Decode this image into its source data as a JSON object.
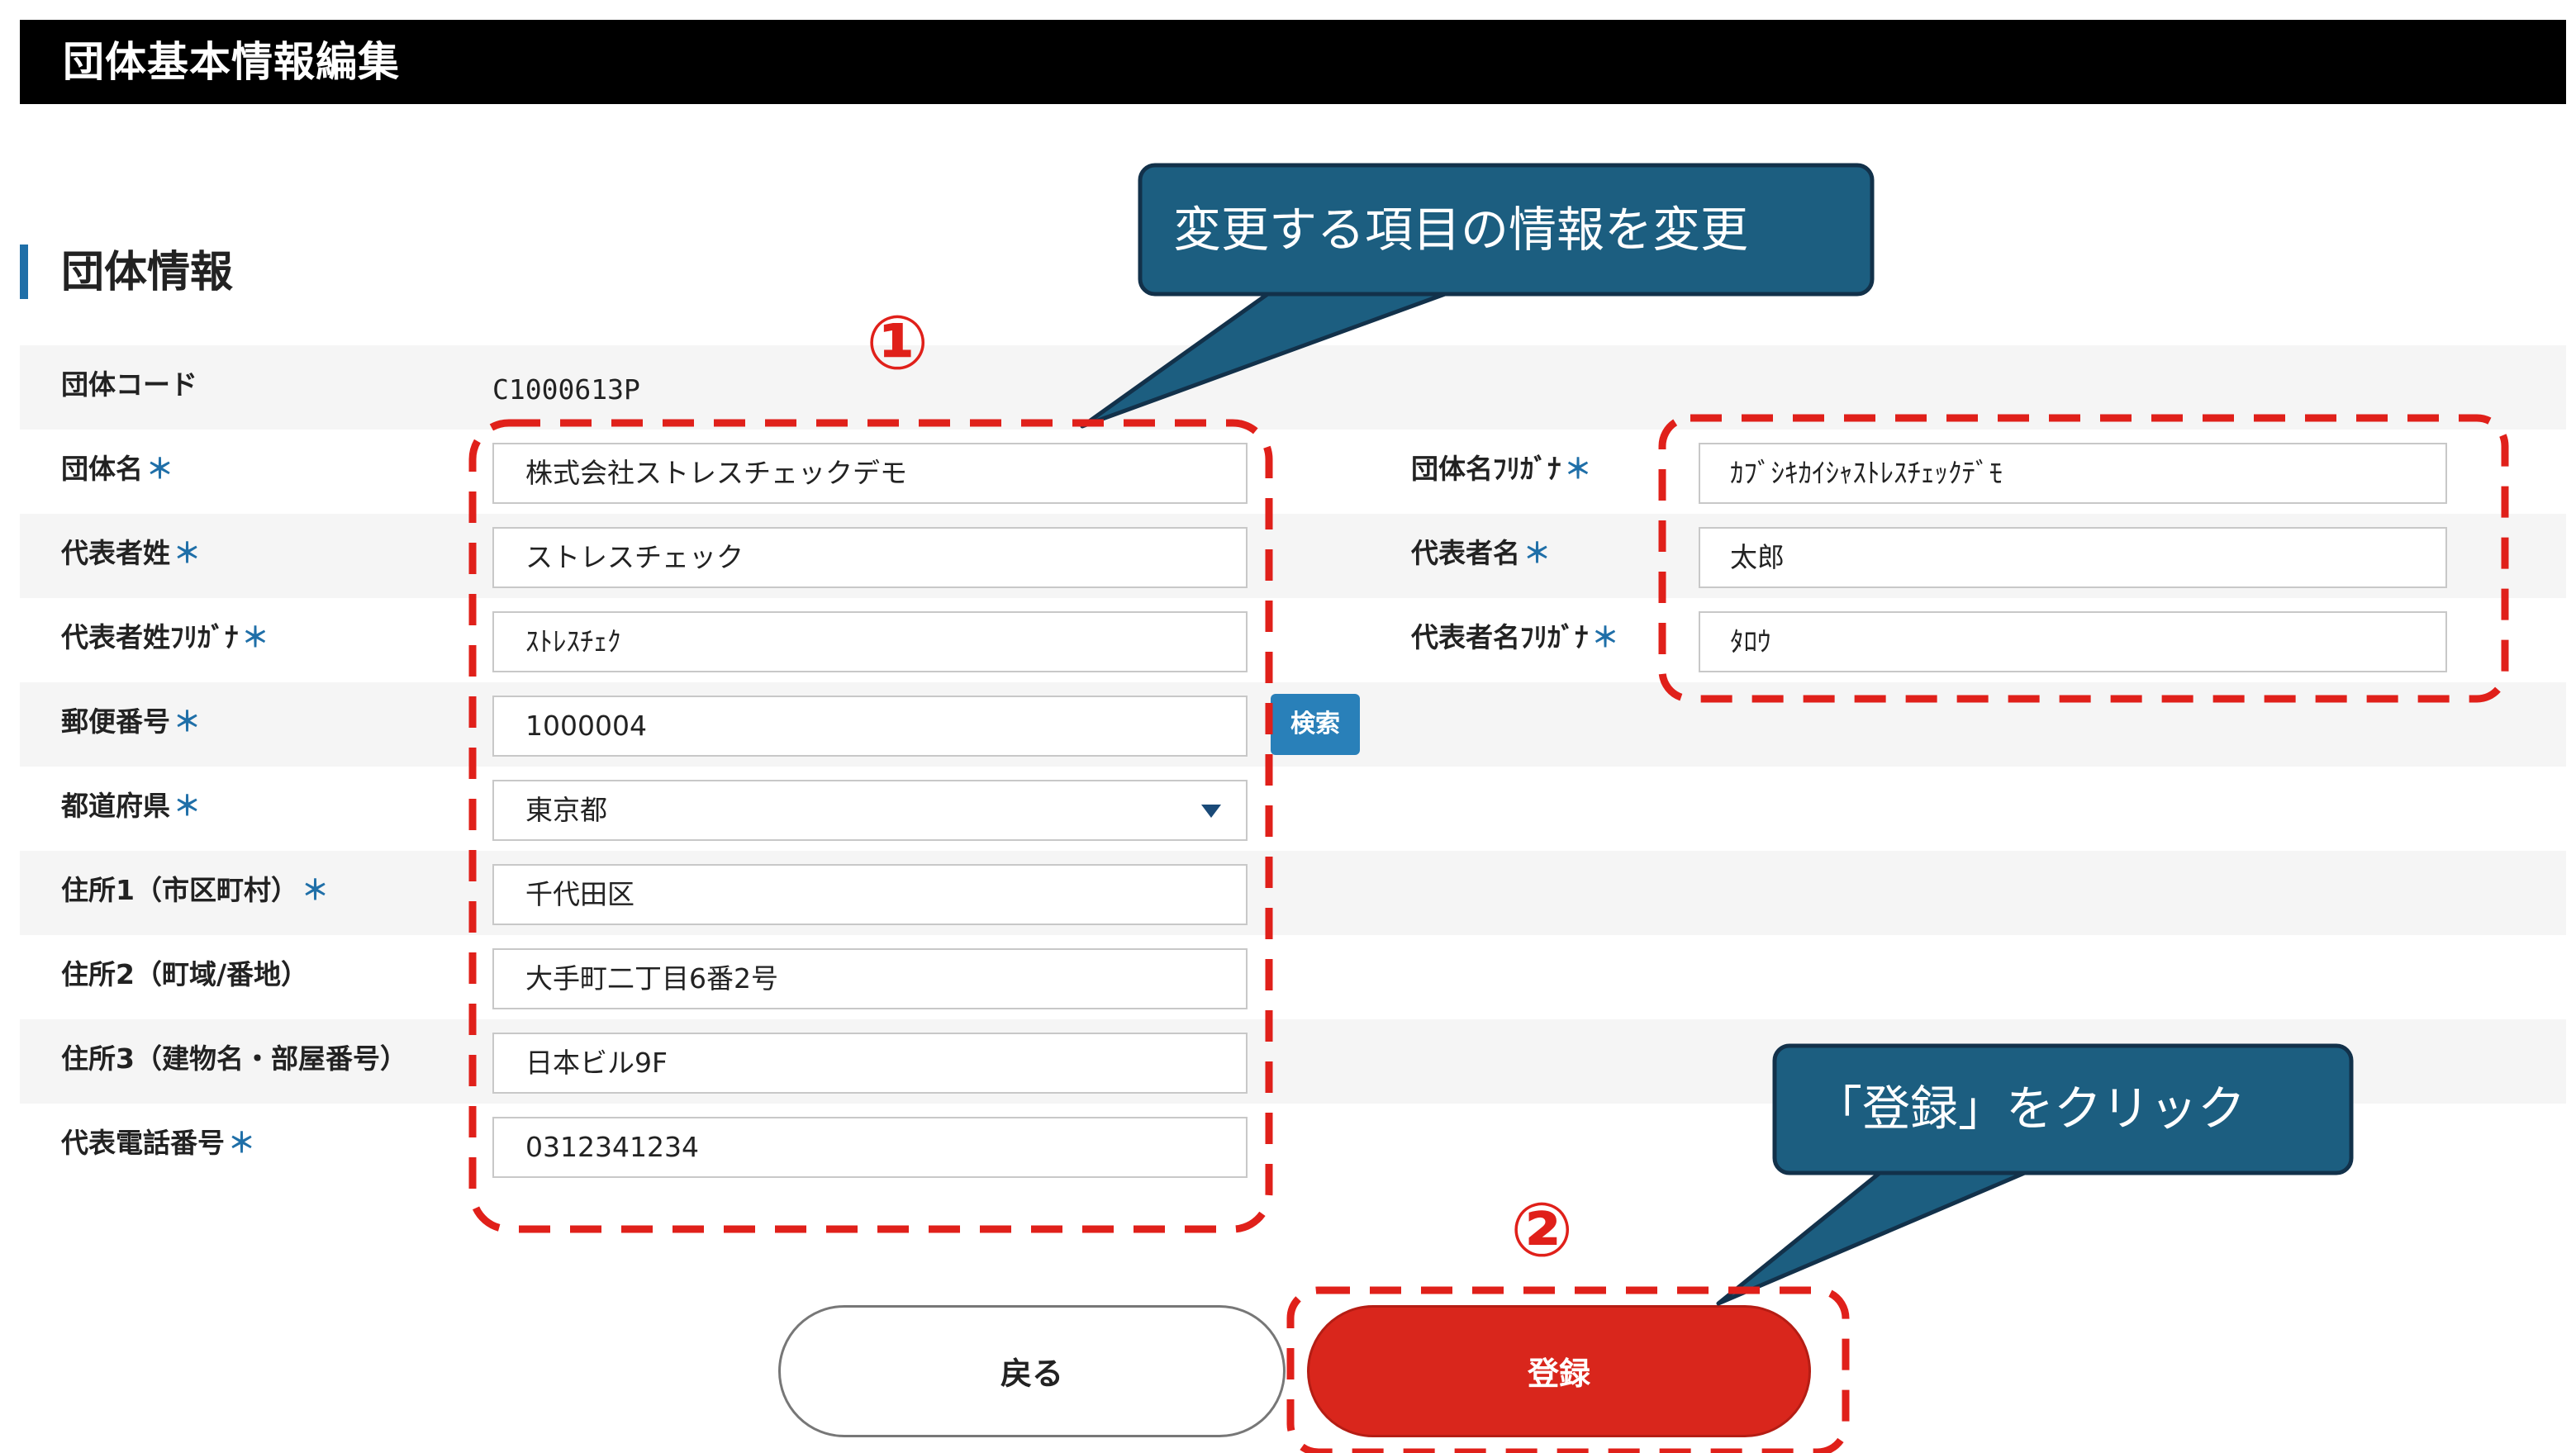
{
  "header": {
    "title": "団体基本情報編集"
  },
  "section": {
    "title": "団体情報"
  },
  "org_code": {
    "label": "団体コード",
    "value": "C1000613P"
  },
  "required_mark": "＊",
  "left_fields": [
    {
      "label": "団体名",
      "value": "株式会社ストレスチェックデモ"
    },
    {
      "label": "代表者姓",
      "value": "ストレスチェック"
    },
    {
      "label": "代表者姓ﾌﾘｶﾞﾅ",
      "value": "ｽﾄﾚｽﾁｪｸ"
    },
    {
      "label": "郵便番号",
      "value": "1000004"
    },
    {
      "label": "都道府県",
      "value": "東京都"
    },
    {
      "label": "住所1（市区町村）",
      "value": "千代田区"
    },
    {
      "label": "住所2（町域/番地）",
      "value": "大手町二丁目6番2号"
    },
    {
      "label": "住所3（建物名・部屋番号）",
      "value": "日本ビル9F"
    },
    {
      "label": "代表電話番号",
      "value": "0312341234"
    }
  ],
  "right_fields": [
    {
      "label": "団体名ﾌﾘｶﾞﾅ",
      "value": "ｶﾌﾞｼｷｶｲｼｬｽﾄﾚｽﾁｪｯｸﾃﾞﾓ"
    },
    {
      "label": "代表者名",
      "value": "太郎"
    },
    {
      "label": "代表者名ﾌﾘｶﾞﾅ",
      "value": "ﾀﾛｳ"
    }
  ],
  "search_button": "検索",
  "buttons": {
    "back": "戻る",
    "register": "登録"
  },
  "callouts": [
    {
      "marker": "①",
      "text": "変更する項目の情報を変更"
    },
    {
      "marker": "②",
      "text": "「登録」をクリック"
    }
  ],
  "colors": {
    "accent": "#1f6fa8",
    "callout_fill": "#1c5e80",
    "highlight_dash": "#e0201a",
    "register_button": "#d9261c"
  }
}
